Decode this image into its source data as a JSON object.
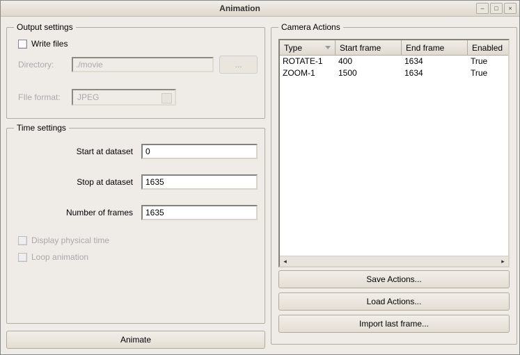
{
  "window": {
    "title": "Animation"
  },
  "output_settings": {
    "legend": "Output settings",
    "write_files_label": "Write files",
    "directory_label": "Directory:",
    "directory_value": "./movie",
    "browse_label": "...",
    "file_format_label": "FIle format:",
    "file_format_value": "JPEG"
  },
  "time_settings": {
    "legend": "Time settings",
    "start_label": "Start at dataset",
    "start_value": "0",
    "stop_label": "Stop at dataset",
    "stop_value": "1635",
    "frames_label": "Number of frames",
    "frames_value": "1635",
    "display_physical_label": "Display physical time",
    "loop_label": "Loop animation"
  },
  "animate_label": "Animate",
  "camera": {
    "legend": "Camera Actions",
    "columns": {
      "type": "Type",
      "start": "Start frame",
      "end": "End frame",
      "enabled": "Enabled"
    },
    "rows": [
      {
        "type": "ROTATE-1",
        "start": "400",
        "end": "1634",
        "enabled": "True"
      },
      {
        "type": "ZOOM-1",
        "start": "1500",
        "end": "1634",
        "enabled": "True"
      }
    ],
    "save_label": "Save Actions...",
    "load_label": "Load Actions...",
    "import_label": "Import last frame..."
  }
}
